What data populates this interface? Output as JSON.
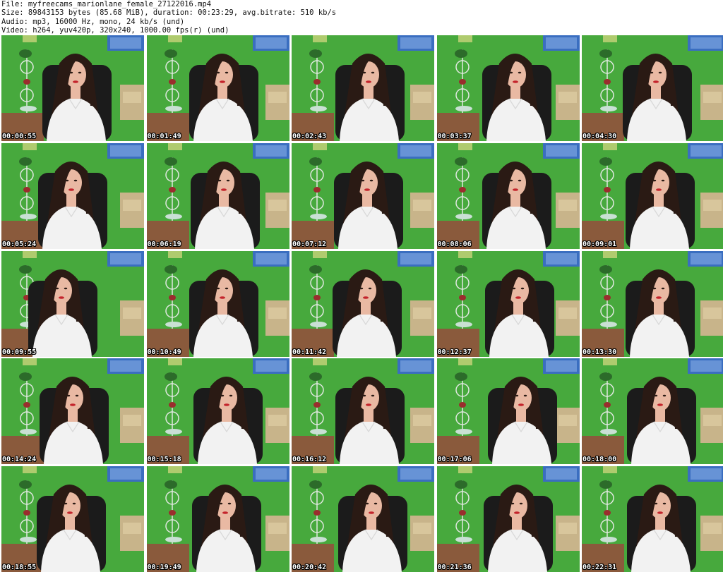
{
  "header": {
    "file_line": "File: myfreecams_marionlane_female_27122016.mp4",
    "size_line": "Size: 89843153 bytes (85.68 MiB), duration: 00:23:29, avg.bitrate: 510 kb/s",
    "audio_line": "Audio: mp3, 16000 Hz, mono, 24 kb/s (und)",
    "video_line": "Video: h264, yuv420p, 320x240, 1000.00 fps(r) (und)"
  },
  "colors": {
    "wall_green": "#3fa236",
    "chair_black": "#1b1b1b",
    "shirt_white": "#f2f2f2",
    "hair_dark": "#2a1a14",
    "skin": "#e9b9a3",
    "floor_brown": "#8a5a3c",
    "sofa_beige": "#c8b48a",
    "poster_blue": "#3a6ec0"
  },
  "thumbnails": [
    {
      "time": "00:00:55"
    },
    {
      "time": "00:01:49"
    },
    {
      "time": "00:02:43"
    },
    {
      "time": "00:03:37"
    },
    {
      "time": "00:04:30"
    },
    {
      "time": "00:05:24"
    },
    {
      "time": "00:06:19"
    },
    {
      "time": "00:07:12"
    },
    {
      "time": "00:08:06"
    },
    {
      "time": "00:09:01"
    },
    {
      "time": "00:09:55"
    },
    {
      "time": "00:10:49"
    },
    {
      "time": "00:11:42"
    },
    {
      "time": "00:12:37"
    },
    {
      "time": "00:13:30"
    },
    {
      "time": "00:14:24"
    },
    {
      "time": "00:15:18"
    },
    {
      "time": "00:16:12"
    },
    {
      "time": "00:17:06"
    },
    {
      "time": "00:18:00"
    },
    {
      "time": "00:18:55"
    },
    {
      "time": "00:19:49"
    },
    {
      "time": "00:20:42"
    },
    {
      "time": "00:21:36"
    },
    {
      "time": "00:22:31"
    }
  ]
}
